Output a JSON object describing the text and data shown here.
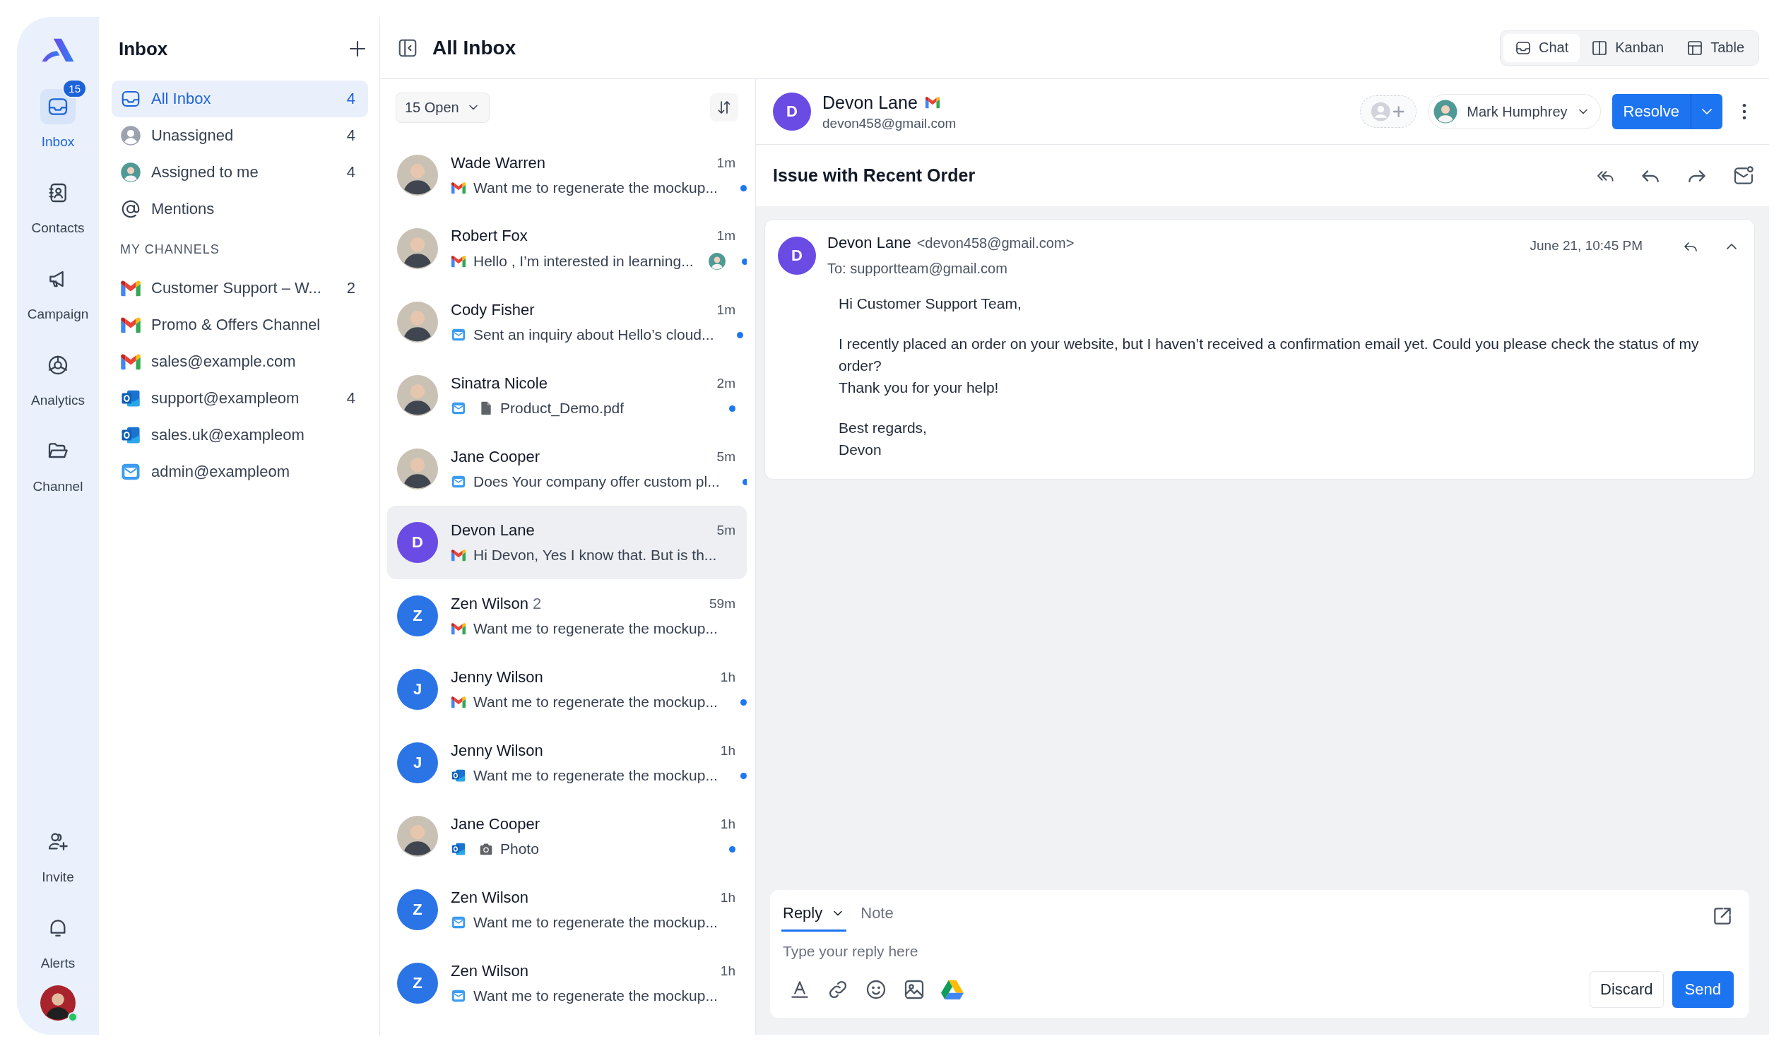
{
  "rail": {
    "badge": "15",
    "items": [
      {
        "label": "Inbox",
        "selected": true
      },
      {
        "label": "Contacts",
        "selected": false
      },
      {
        "label": "Campaign",
        "selected": false
      },
      {
        "label": "Analytics",
        "selected": false
      },
      {
        "label": "Channel",
        "selected": false
      }
    ],
    "bottom_items": [
      {
        "label": "Invite"
      },
      {
        "label": "Alerts"
      }
    ],
    "user": {
      "online": true
    }
  },
  "inbox_panel": {
    "title": "Inbox",
    "items": [
      {
        "label": "All Inbox",
        "count": "4",
        "selected": true
      },
      {
        "label": "Unassigned",
        "count": "4",
        "selected": false
      },
      {
        "label": "Assigned to me",
        "count": "4",
        "selected": false
      },
      {
        "label": "Mentions",
        "selected": false
      }
    ],
    "section_title": "MY CHANNELS",
    "channels": [
      {
        "label": "Customer Support – W...",
        "count": "2",
        "kind": "gmail",
        "selected": false
      },
      {
        "label": "Promo & Offers Channel",
        "kind": "gmail",
        "selected": false
      },
      {
        "label": "sales@example.com",
        "kind": "gmail",
        "selected": false
      },
      {
        "label": "support@exampleom",
        "count": "4",
        "kind": "outlook",
        "selected": false
      },
      {
        "label": "sales.uk@exampleom",
        "kind": "outlook",
        "selected": false
      },
      {
        "label": "admin@exampleom",
        "kind": "mail",
        "selected": false
      }
    ]
  },
  "list": {
    "title": "All Inbox",
    "filter": "15 Open",
    "conversations": [
      {
        "name": "Wade Warren",
        "time": "1m",
        "kind": "gmail",
        "preview": "Want me to regenerate the mockup...",
        "avatar": {
          "kind": "photo"
        },
        "unread": true,
        "selected": false
      },
      {
        "name": "Robert Fox",
        "time": "1m",
        "kind": "gmail",
        "preview": "Hello , I’m interested in learning...",
        "avatar": {
          "kind": "photo"
        },
        "unread": true,
        "assignee": true,
        "selected": false
      },
      {
        "name": "Cody Fisher",
        "time": "1m",
        "kind": "mail",
        "preview": "Sent an inquiry about Hello’s cloud...",
        "avatar": {
          "kind": "photo"
        },
        "unread": true,
        "selected": false
      },
      {
        "name": "Sinatra Nicole",
        "time": "2m",
        "kind": "mail",
        "attachment": {
          "kind": "file"
        },
        "preview": "Product_Demo.pdf",
        "avatar": {
          "kind": "photo"
        },
        "unread": true,
        "selected": false
      },
      {
        "name": "Jane Cooper",
        "time": "5m",
        "kind": "mail",
        "preview": "Does Your company offer custom pl...",
        "avatar": {
          "kind": "photo"
        },
        "unread": true,
        "selected": false
      },
      {
        "name": "Devon Lane",
        "time": "5m",
        "kind": "gmail",
        "preview": "Hi Devon, Yes I know that. But is th...",
        "avatar": {
          "kind": "initial",
          "initial": "D",
          "color": "#6a4be4"
        },
        "unread": false,
        "selected": true
      },
      {
        "name": "Zen Wilson",
        "count": "2",
        "time": "59m",
        "kind": "gmail",
        "preview": "Want me to regenerate the mockup...",
        "avatar": {
          "kind": "initial",
          "initial": "Z",
          "color": "#2b74e6"
        },
        "unread": false,
        "selected": false
      },
      {
        "name": "Jenny Wilson",
        "time": "1h",
        "kind": "gmail",
        "preview": "Want me to regenerate the mockup...",
        "avatar": {
          "kind": "initial",
          "initial": "J",
          "color": "#2b74e6"
        },
        "unread": true,
        "selected": false
      },
      {
        "name": "Jenny Wilson",
        "time": "1h",
        "kind": "outlook",
        "preview": "Want me to regenerate the mockup...",
        "avatar": {
          "kind": "initial",
          "initial": "J",
          "color": "#2b74e6"
        },
        "unread": true,
        "selected": false
      },
      {
        "name": "Jane Cooper",
        "time": "1h",
        "kind": "outlook",
        "attachment": {
          "kind": "photo"
        },
        "preview": "Photo",
        "avatar": {
          "kind": "photo"
        },
        "unread": true,
        "selected": false
      },
      {
        "name": "Zen Wilson",
        "time": "1h",
        "kind": "mail",
        "preview": "Want me to regenerate the mockup...",
        "avatar": {
          "kind": "initial",
          "initial": "Z",
          "color": "#2b74e6"
        },
        "unread": false,
        "selected": false
      },
      {
        "name": "Zen Wilson",
        "time": "1h",
        "kind": "mail",
        "preview": "Want me to regenerate the mockup...",
        "avatar": {
          "kind": "initial",
          "initial": "Z",
          "color": "#2b74e6"
        },
        "unread": false,
        "selected": false
      }
    ]
  },
  "views": [
    {
      "label": "Chat",
      "selected": true
    },
    {
      "label": "Kanban",
      "selected": false
    },
    {
      "label": "Table",
      "selected": false
    }
  ],
  "contact": {
    "initial": "D",
    "color": "#6a4be4",
    "name": "Devon Lane",
    "kind": "gmail",
    "email": "devon458@gmail.com",
    "assignee": "Mark Humphrey",
    "action": "Resolve"
  },
  "subject": "Issue with Recent Order",
  "message": {
    "initial": "D",
    "color": "#6a4be4",
    "sender": "Devon Lane",
    "sender_email": "<devon458@gmail.com>",
    "to": "To: supportteam@gmail.com",
    "time": "June 21, 10:45 PM",
    "paragraphs": [
      [
        "Hi Customer Support Team,"
      ],
      [
        "I recently placed an order on your website, but I haven’t received a confirmation email yet. Could you please check the status of my order?",
        "Thank you for your help!"
      ],
      [
        "Best regards,",
        "Devon"
      ]
    ]
  },
  "composer": {
    "tabs": [
      {
        "label": "Reply",
        "selected": true,
        "dropdown": true
      },
      {
        "label": "Note",
        "selected": false,
        "dropdown": false
      }
    ],
    "placeholder": "Type your reply here",
    "discard": "Discard",
    "send": "Send"
  }
}
